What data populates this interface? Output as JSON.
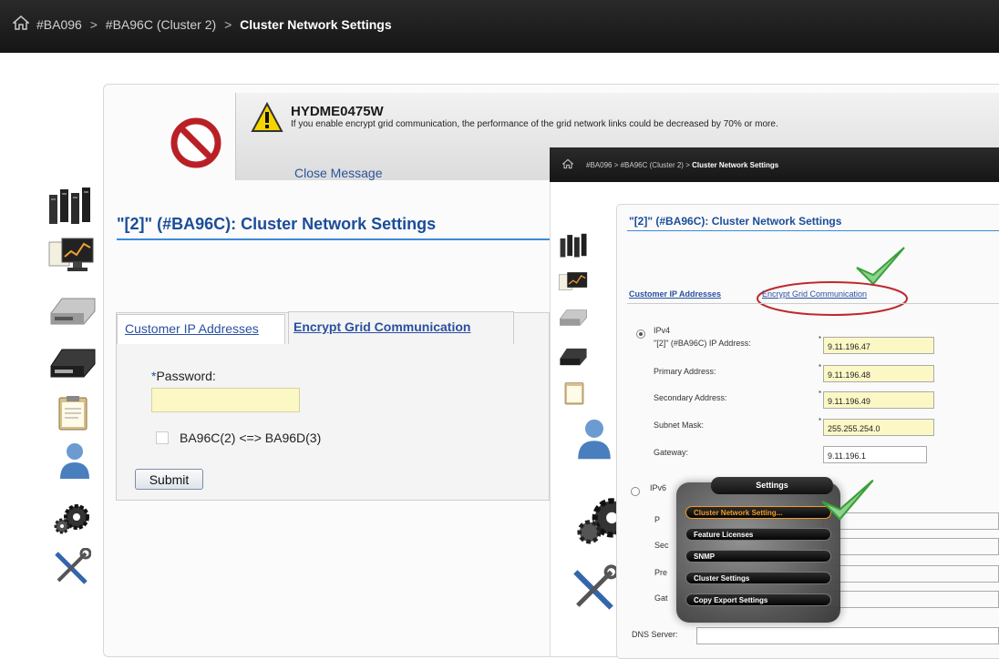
{
  "breadcrumb": {
    "items": [
      "#BA096",
      "#BA96C (Cluster 2)"
    ],
    "separator": ">",
    "current": "Cluster Network Settings"
  },
  "message": {
    "code": "HYDME0475W",
    "text": "If you enable encrypt grid communication, the performance of the grid network links could be decreased by 70% or more.",
    "close_label": "Close Message"
  },
  "page": {
    "title": "\"[2]\" (#BA96C): Cluster Network Settings"
  },
  "tabs": {
    "customer_ip": "Customer IP Addresses",
    "encrypt_grid": "Encrypt Grid Communication"
  },
  "form": {
    "password_required_marker": "*",
    "password_label": "Password:",
    "password_value": "",
    "link_label": "BA96C(2) <=> BA96D(3)",
    "submit_label": "Submit"
  },
  "overlay": {
    "breadcrumb": {
      "items": [
        "#BA096",
        "#BA96C (Cluster 2)"
      ],
      "separator": ">",
      "current": "Cluster Network Settings"
    },
    "title": "\"[2]\" (#BA96C): Cluster Network Settings",
    "tabs": {
      "customer_ip": "Customer IP Addresses",
      "encrypt_grid": "Encrypt Grid Communication"
    },
    "ipv4_label": "IPv4",
    "ipv6_label": "IPv6",
    "fields": [
      {
        "label": "\"[2]\" (#BA96C) IP Address:",
        "value": "9.11.196.47",
        "required": true
      },
      {
        "label": "Primary Address:",
        "value": "9.11.196.48",
        "required": true
      },
      {
        "label": "Secondary Address:",
        "value": "9.11.196.49",
        "required": true
      },
      {
        "label": "Subnet Mask:",
        "value": "255.255.254.0",
        "required": true
      },
      {
        "label": "Gateway:",
        "value": "9.11.196.1",
        "required": false
      }
    ],
    "ipv6_partial_labels": [
      "P",
      "Sec",
      "Pre",
      "Gat"
    ],
    "dns_label": "DNS Server:",
    "dns_value": ""
  },
  "settings_menu": {
    "title": "Settings",
    "items": [
      {
        "label": "Cluster Network Setting...",
        "active": true
      },
      {
        "label": "Feature Licenses",
        "active": false
      },
      {
        "label": "SNMP",
        "active": false
      },
      {
        "label": "Cluster Settings",
        "active": false
      },
      {
        "label": "Copy Export Settings",
        "active": false
      }
    ]
  },
  "colors": {
    "link_blue": "#2a4fa0",
    "title_blue": "#1b4d99",
    "input_yellow": "#fcf8c6",
    "checkmark_green": "#3aa03a",
    "highlight_red": "#c0282d",
    "menu_active_orange": "#f19a2a"
  },
  "icons": [
    "home-icon",
    "cluster-icon",
    "monitor-chart-icon",
    "drive-icon",
    "dark-drive-icon",
    "clipboard-icon",
    "user-icon",
    "gears-icon",
    "tools-icon",
    "prohibited-icon",
    "warning-icon",
    "checkmark-icon"
  ]
}
